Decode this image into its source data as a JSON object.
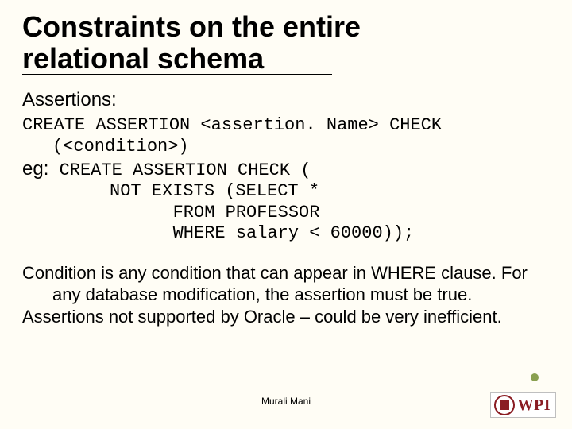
{
  "title": {
    "line1": "Constraints on the entire",
    "line2": "relational schema"
  },
  "subhead": "Assertions:",
  "syntax": {
    "line1": "CREATE ASSERTION <assertion. Name> CHECK",
    "line2": "(<condition>)"
  },
  "example": {
    "label": "eg:",
    "code1": " CREATE ASSERTION CHECK (",
    "code2": "NOT EXISTS (SELECT *",
    "code3": "   FROM PROFESSOR",
    "code4": "   WHERE salary < 60000));"
  },
  "para1": "Condition is any condition that can appear in WHERE clause. For any database modification, the assertion must be true.",
  "para2": "Assertions not supported by Oracle – could be very inefficient.",
  "footer_author": "Murali Mani",
  "logo_text": "WPI"
}
